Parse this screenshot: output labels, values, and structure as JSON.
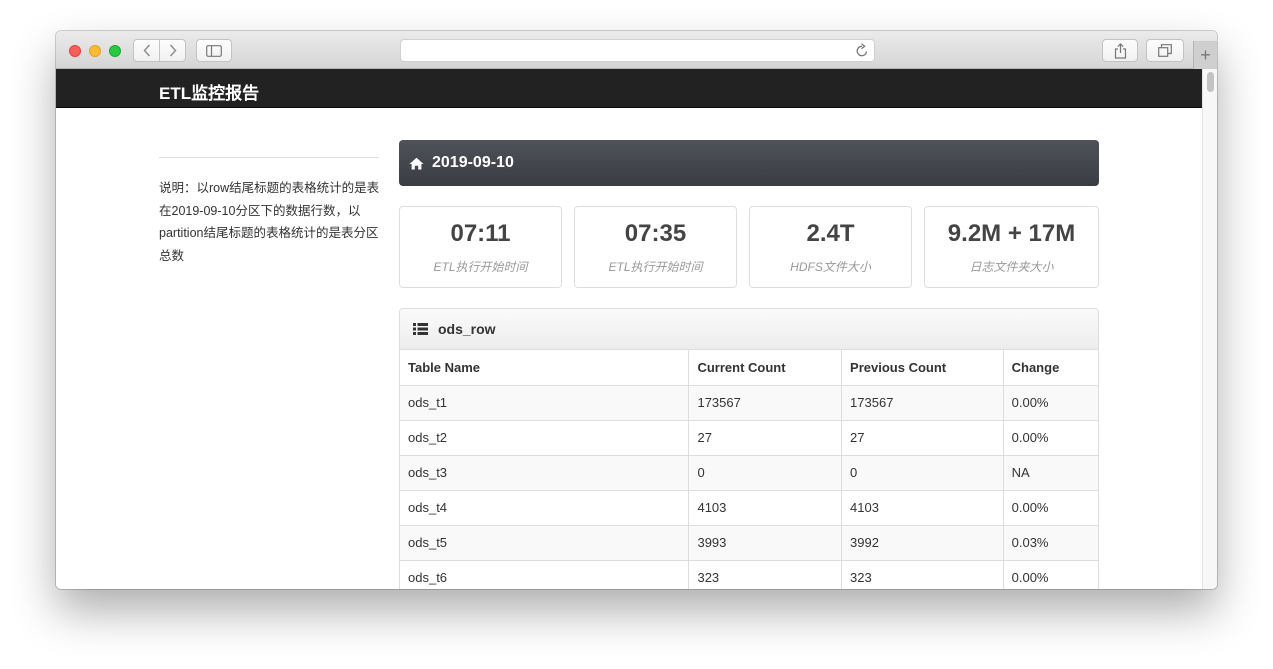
{
  "browser": {
    "address": "",
    "controls": {
      "back_icon": "chevron-left-icon",
      "forward_icon": "chevron-right-icon",
      "sidebar_icon": "sidebar-icon",
      "reload_icon": "reload-icon",
      "share_icon": "share-icon",
      "tabs_icon": "tabs-icon",
      "new_tab_label": "+"
    }
  },
  "navbar": {
    "brand": "ETL监控报告"
  },
  "sidebar": {
    "note": "说明：以row结尾标题的表格统计的是表在2019-09-10分区下的数据行数，以partition结尾标题的表格统计的是表分区总数"
  },
  "date_panel": {
    "icon": "home-icon",
    "date": "2019-09-10",
    "color": "#3f4248"
  },
  "stats": [
    {
      "value": "07:11",
      "label": "ETL执行开始时间"
    },
    {
      "value": "07:35",
      "label": "ETL执行开始时间"
    },
    {
      "value": "2.4T",
      "label": "HDFS文件大小"
    },
    {
      "value": "9.2M + 17M",
      "label": "日志文件夹大小"
    }
  ],
  "table_panel": {
    "icon": "list-icon",
    "title": "ods_row",
    "columns": [
      "Table Name",
      "Current Count",
      "Previous Count",
      "Change"
    ],
    "rows": [
      [
        "ods_t1",
        "173567",
        "173567",
        "0.00%"
      ],
      [
        "ods_t2",
        "27",
        "27",
        "0.00%"
      ],
      [
        "ods_t3",
        "0",
        "0",
        "NA"
      ],
      [
        "ods_t4",
        "4103",
        "4103",
        "0.00%"
      ],
      [
        "ods_t5",
        "3993",
        "3992",
        "0.03%"
      ],
      [
        "ods_t6",
        "323",
        "323",
        "0.00%"
      ]
    ]
  }
}
